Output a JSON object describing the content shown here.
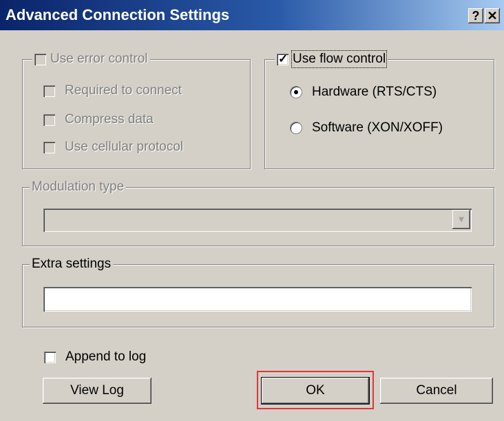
{
  "window": {
    "title": "Advanced Connection Settings",
    "help_glyph": "?",
    "close_glyph": "✕"
  },
  "error_control": {
    "label": "Use error control",
    "enabled": false,
    "checked": false,
    "options": [
      {
        "label": "Required to connect",
        "checked": false
      },
      {
        "label": "Compress data",
        "checked": false
      },
      {
        "label": "Use cellular protocol",
        "checked": false
      }
    ]
  },
  "flow_control": {
    "label": "Use flow control",
    "checked": true,
    "options": [
      {
        "label": "Hardware (RTS/CTS)",
        "selected": true
      },
      {
        "label": "Software (XON/XOFF)",
        "selected": false
      }
    ]
  },
  "modulation": {
    "label": "Modulation type",
    "enabled": false,
    "value": ""
  },
  "extra_settings": {
    "label": "Extra settings",
    "value": ""
  },
  "append_log": {
    "label": "Append to log",
    "checked": false
  },
  "buttons": {
    "view_log": "View Log",
    "ok": "OK",
    "cancel": "Cancel"
  },
  "colors": {
    "highlight": "#e0363a",
    "title_bar": "#0a246a"
  }
}
